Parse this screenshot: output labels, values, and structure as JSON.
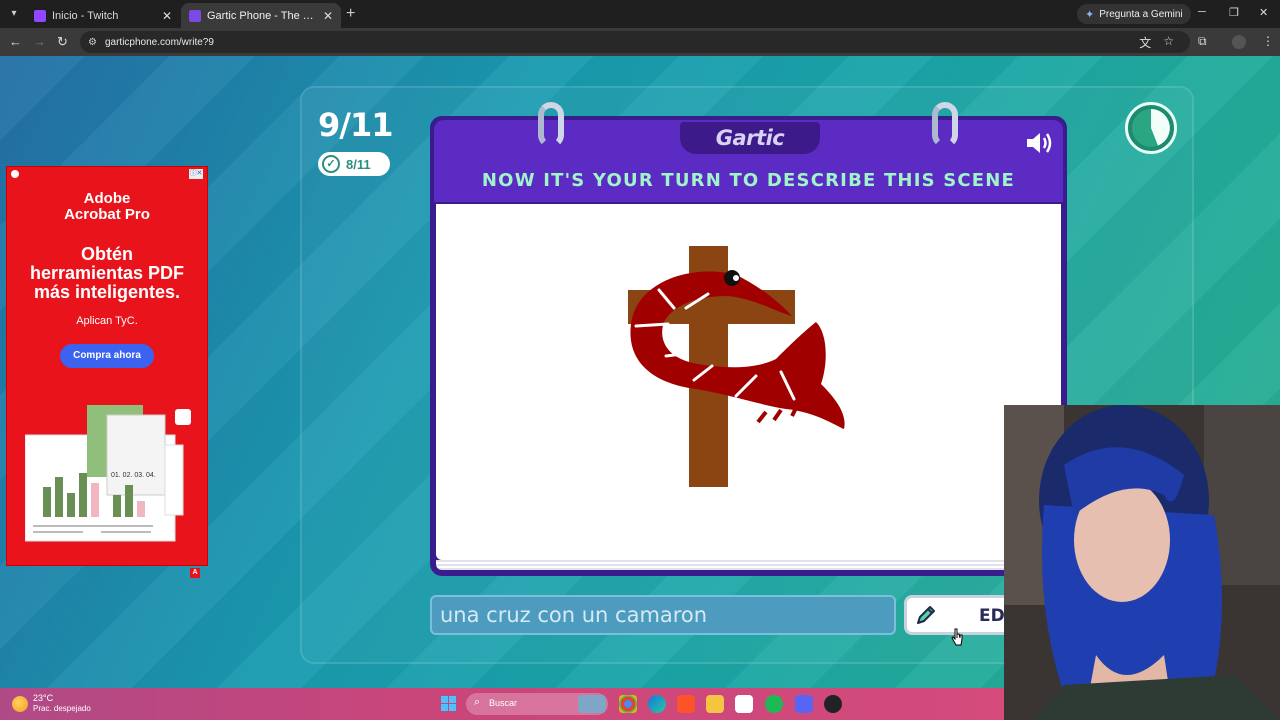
{
  "browser": {
    "tabs": [
      {
        "title": "Inicio - Twitch",
        "favicon_color": "#9146ff",
        "active": false
      },
      {
        "title": "Gartic Phone - The Telephone Game",
        "favicon_color": "#7b4ae2",
        "active": true
      }
    ],
    "gemini_label": "Pregunta a Gemini",
    "url": "garticphone.com/write?9"
  },
  "game": {
    "round": "9/11",
    "done_count": "8/11",
    "logo": "Gartic",
    "heading": "NOW IT'S YOUR TURN TO DESCRIBE THIS SCENE",
    "answer_value": "una cruz con un camaron",
    "edit_label": "EDIT",
    "timer_remaining_fraction": 0.7,
    "colors": {
      "card": "#5b2bc4",
      "heading": "#9ff5c8",
      "cross": "#8b4513",
      "shrimp": "#a10000"
    }
  },
  "ad": {
    "brand_line1": "Adobe",
    "brand_line2": "Acrobat Pro",
    "headline_1": "Obtén",
    "headline_2": "herramientas PDF",
    "headline_3": "más inteligentes.",
    "terms": "Aplican TyC.",
    "cta": "Compra ahora",
    "chart_ticks": "01. 02. 03. 04."
  },
  "taskbar": {
    "temperature": "23°C",
    "weather": "Prac. despejado",
    "search_placeholder": "Buscar"
  }
}
